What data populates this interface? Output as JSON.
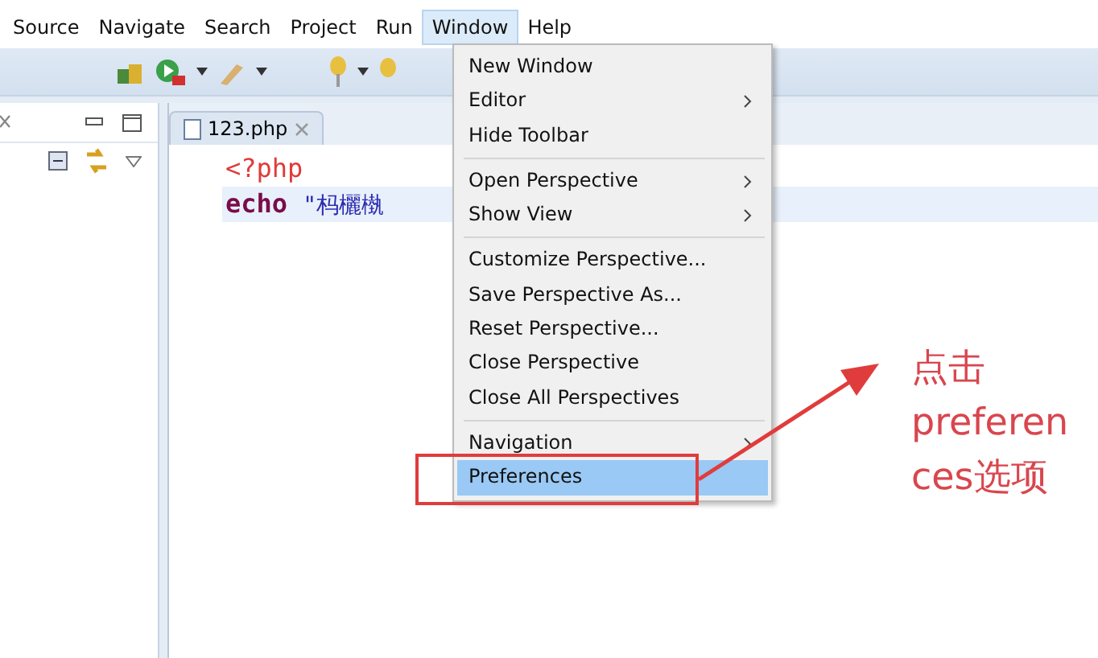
{
  "menu_bar": [
    {
      "label": "Source",
      "selected": false
    },
    {
      "label": "Navigate",
      "selected": false
    },
    {
      "label": "Search",
      "selected": false
    },
    {
      "label": "Project",
      "selected": false
    },
    {
      "label": "Run",
      "selected": false
    },
    {
      "label": "Window",
      "selected": true
    },
    {
      "label": "Help",
      "selected": false
    }
  ],
  "editor": {
    "tab": "123.php",
    "lines": [
      {
        "kind": "tag",
        "text": "<?php",
        "current": false
      },
      {
        "kind": "echo",
        "keyword": "echo",
        "text": "\"杩欐槸",
        "current": true
      }
    ]
  },
  "window_menu": [
    {
      "kind": "item",
      "label": "New Window",
      "submenu": false,
      "selected": false
    },
    {
      "kind": "item",
      "label": "Editor",
      "submenu": true,
      "selected": false
    },
    {
      "kind": "item",
      "label": "Hide Toolbar",
      "submenu": false,
      "selected": false
    },
    {
      "kind": "separator"
    },
    {
      "kind": "item",
      "label": "Open Perspective",
      "submenu": true,
      "selected": false
    },
    {
      "kind": "item",
      "label": "Show View",
      "submenu": true,
      "selected": false
    },
    {
      "kind": "separator"
    },
    {
      "kind": "item",
      "label": "Customize Perspective...",
      "submenu": false,
      "selected": false
    },
    {
      "kind": "item",
      "label": "Save Perspective As...",
      "submenu": false,
      "selected": false
    },
    {
      "kind": "item",
      "label": "Reset Perspective...",
      "submenu": false,
      "selected": false
    },
    {
      "kind": "item",
      "label": "Close Perspective",
      "submenu": false,
      "selected": false
    },
    {
      "kind": "item",
      "label": "Close All Perspectives",
      "submenu": false,
      "selected": false
    },
    {
      "kind": "separator"
    },
    {
      "kind": "item",
      "label": "Navigation",
      "submenu": true,
      "selected": false
    },
    {
      "kind": "item",
      "label": "Preferences",
      "submenu": false,
      "selected": true
    }
  ],
  "annotation": {
    "lines": [
      "点击",
      "preferen",
      "ces选项"
    ]
  }
}
